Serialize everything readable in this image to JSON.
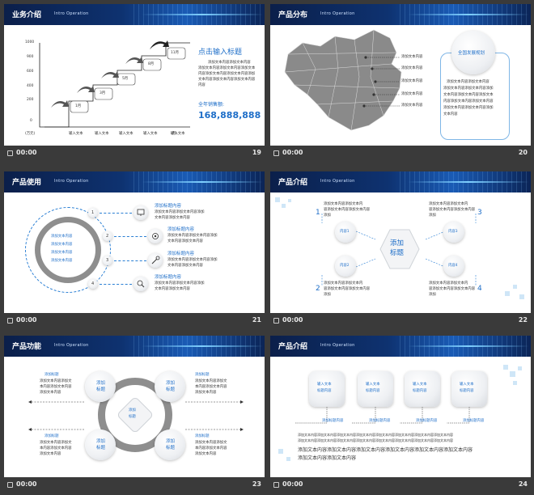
{
  "colors": {
    "header_dark": "#0b1f4a",
    "header_light": "#1a5bb5",
    "accent_blue": "#1e6ec8",
    "footer_bg": "#3a3a3a",
    "gray_map": "#8a8a8a"
  },
  "footer_time": "00:00",
  "slides": [
    {
      "number": "19",
      "title": "业务介绍",
      "subtitle": "Intro Operation",
      "chart_data": {
        "type": "bar",
        "categories": [
          "1月",
          "3月",
          "5月",
          "8月",
          "11月"
        ],
        "x_tick_labels": [
          "输入文本",
          "输入文本",
          "输入文本",
          "输入文本",
          "输入文本"
        ],
        "y_ticks": [
          "1000",
          "900",
          "600",
          "400",
          "200",
          "0"
        ],
        "y_unit": "(万元)",
        "x_unit": "(月)"
      },
      "heading": "点击输入标题",
      "body": [
        "添加文本内容添加文本内容",
        "添加文本内容添加文本内容添加文本",
        "内容添加文本内容添加文本内容添加",
        "文本内容添加文本内容添加文本内容",
        "内容"
      ],
      "total_label": "全年销售额:",
      "total_value": "168,888,888"
    },
    {
      "number": "20",
      "title": "产品分布",
      "subtitle": "Intro Operation",
      "map_labels": [
        "添加文本内容",
        "添加文本内容",
        "添加文本内容",
        "添加文本内容",
        "添加文本内容"
      ],
      "plan_title": "全国发展规划",
      "plan_body": [
        "添加文本内容添加文本内容",
        "添加文本内容添加文本内容添加",
        "文本内容添加文本内容添加文本",
        "内容添加文本内容添加文本内容",
        "添加文本内容添加文本内容添加",
        "文本内容"
      ]
    },
    {
      "number": "21",
      "title": "产品使用",
      "subtitle": "Intro Operation",
      "center_text": [
        "添加文本内容",
        "添加文本内容",
        "添加文本内容",
        "添加文本内容"
      ],
      "items": [
        {
          "num": "1",
          "title": "添加标题内容",
          "body": [
            "添加文本内容添加文本内容添加",
            "文本内容添加文本内容"
          ]
        },
        {
          "num": "2",
          "title": "添加标题内容",
          "body": [
            "添加文本内容添加文本内容添加",
            "文本内容添加文本内容"
          ]
        },
        {
          "num": "3",
          "title": "添加标题内容",
          "body": [
            "添加文本内容添加文本内容添加",
            "文本内容添加文本内容"
          ]
        },
        {
          "num": "4",
          "title": "添加标题内容",
          "body": [
            "添加文本内容添加文本内容添加",
            "文本内容添加文本内容"
          ]
        }
      ]
    },
    {
      "number": "22",
      "title": "产品介绍",
      "subtitle": "Intro Operation",
      "center": [
        "添加",
        "标题"
      ],
      "nodes": [
        {
          "num": "1",
          "label": "内容1",
          "body": [
            "添加文本内容添加文本内",
            "容添加文本内容添加文本内容",
            "添加"
          ]
        },
        {
          "num": "2",
          "label": "内容2",
          "body": [
            "添加文本内容添加文本内",
            "容添加文本内容添加文本内容",
            "添加"
          ]
        },
        {
          "num": "3",
          "label": "内容3",
          "body": [
            "添加文本内容添加文本内",
            "容添加文本内容添加文本内容",
            "添加"
          ]
        },
        {
          "num": "4",
          "label": "内容4",
          "body": [
            "添加文本内容添加文本内",
            "容添加文本内容添加文本内容",
            "添加"
          ]
        }
      ]
    },
    {
      "number": "23",
      "title": "产品功能",
      "subtitle": "Intro Operation",
      "center": [
        "添加",
        "标题"
      ],
      "nodes": [
        {
          "label": [
            "添加",
            "标题"
          ],
          "title": "添加标题",
          "body": [
            "添加文本内容添加文",
            "本内容添加文本内容",
            "添加文本内容"
          ]
        },
        {
          "label": [
            "添加",
            "标题"
          ],
          "title": "添加标题",
          "body": [
            "添加文本内容添加文",
            "本内容添加文本内容",
            "添加文本内容"
          ]
        },
        {
          "label": [
            "添加",
            "标题"
          ],
          "title": "添加标题",
          "body": [
            "添加文本内容添加文",
            "本内容添加文本内容",
            "添加文本内容"
          ]
        },
        {
          "label": [
            "添加",
            "标题"
          ],
          "title": "添加标题",
          "body": [
            "添加文本内容添加文",
            "本内容添加文本内容",
            "添加文本内容"
          ]
        }
      ]
    },
    {
      "number": "24",
      "title": "产品介绍",
      "subtitle": "Intro Operation",
      "cards": [
        {
          "text": [
            "输入文本",
            "标题内容"
          ],
          "title": "添加标题内容"
        },
        {
          "text": [
            "输入文本",
            "标题内容"
          ],
          "title": "添加标题内容"
        },
        {
          "text": [
            "输入文本",
            "标题内容"
          ],
          "title": "添加标题内容"
        },
        {
          "text": [
            "输入文本",
            "标题内容"
          ],
          "title": "添加标题内容"
        }
      ],
      "small_text": [
        "添加文本内容添加文本内容添加文本内容添加文本内容添加文本内容添加文本内容添加文本内容添加文本内容",
        "添加文本内容添加文本内容添加文本内容添加文本内容添加文本内容添加文本内容添加文本内容添加文本内容"
      ],
      "big_text": [
        "添加文本内容添加文本内容添加文本内容添加文本内容添加文本内容添加文本内容",
        "添加文本内容添加文本内容"
      ]
    }
  ]
}
